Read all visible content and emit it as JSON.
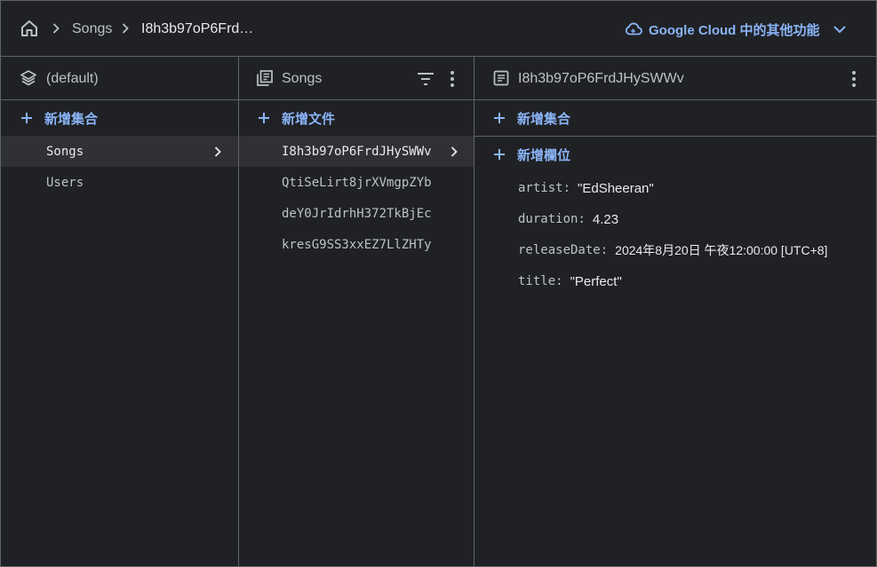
{
  "breadcrumb": {
    "items": [
      "Songs",
      "I8h3b97oP6Frd…"
    ]
  },
  "top_link": {
    "label": "Google Cloud 中的其他功能"
  },
  "colors": {
    "accent": "#8ab4f8",
    "background": "#202124",
    "selected_row": "#303134",
    "border": "#5f6368"
  },
  "database_panel": {
    "title": "(default)",
    "add_label": "新增集合",
    "collections": [
      "Songs",
      "Users"
    ],
    "selected_index": 0
  },
  "collection_panel": {
    "title": "Songs",
    "add_label": "新增文件",
    "documents": [
      "I8h3b97oP6FrdJHySWWv",
      "QtiSeLirt8jrXVmgpZYb",
      "deY0JrIdrhH372TkBjEc",
      "kresG9SS3xxEZ7LlZHTy"
    ],
    "selected_index": 0
  },
  "document_panel": {
    "title": "I8h3b97oP6FrdJHySWWv",
    "add_collection_label": "新增集合",
    "add_field_label": "新增欄位",
    "fields": [
      {
        "key": "artist",
        "value": "\"EdSheeran\""
      },
      {
        "key": "duration",
        "value": "4.23"
      },
      {
        "key": "releaseDate",
        "value": "2024年8月20日 午夜12:00:00 [UTC+8]"
      },
      {
        "key": "title",
        "value": "\"Perfect\""
      }
    ]
  }
}
